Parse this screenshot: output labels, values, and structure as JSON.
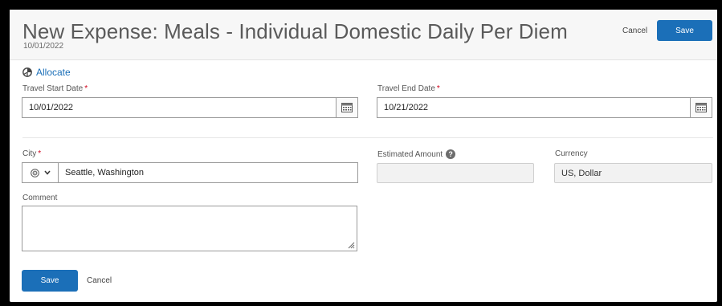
{
  "header": {
    "title": "New Expense: Meals - Individual Domestic Daily Per Diem",
    "date": "10/01/2022",
    "cancel_label": "Cancel",
    "save_label": "Save"
  },
  "allocate": {
    "label": "Allocate",
    "icon": "pie-chart-icon"
  },
  "travel_start": {
    "label": "Travel Start Date",
    "required": "*",
    "value": "10/01/2022",
    "icon": "calendar-icon"
  },
  "travel_end": {
    "label": "Travel End Date",
    "required": "*",
    "value": "10/21/2022",
    "icon": "calendar-icon"
  },
  "city": {
    "label": "City",
    "required": "*",
    "value": "Seattle, Washington",
    "icon": "globe-icon"
  },
  "estimated_amount": {
    "label": "Estimated Amount",
    "value": "",
    "info_icon": "?"
  },
  "currency": {
    "label": "Currency",
    "value": "US, Dollar"
  },
  "comment": {
    "label": "Comment",
    "value": ""
  },
  "footer": {
    "save_label": "Save",
    "cancel_label": "Cancel"
  },
  "colors": {
    "primary": "#1b6fb8",
    "required": "#d0021b",
    "link": "#1b6fb8"
  }
}
